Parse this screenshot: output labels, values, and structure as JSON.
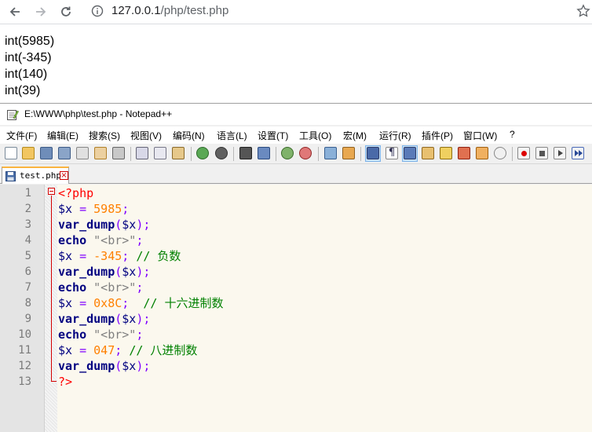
{
  "browser": {
    "url_host": "127.0.0.1",
    "url_path": "/php/test.php",
    "icons": [
      "back-arrow-icon",
      "forward-arrow-icon",
      "reload-icon",
      "info-icon",
      "bookmark-star-icon"
    ]
  },
  "page_output": [
    "int(5985)",
    "int(-345)",
    "int(140)",
    "int(39)"
  ],
  "notepad": {
    "title": "E:\\WWW\\php\\test.php - Notepad++",
    "menu": [
      "文件(F)",
      "编辑(E)",
      "搜索(S)",
      "视图(V)",
      "编码(N)",
      "语言(L)",
      "设置(T)",
      "工具(O)",
      "宏(M)",
      "运行(R)",
      "插件(P)",
      "窗口(W)",
      "?"
    ],
    "tab_label": "test.php",
    "current_line": 8,
    "colors": {
      "tag": "#ff0000",
      "variable": "#000080",
      "operator": "#8000ff",
      "number": "#ff8000",
      "keyword": "#000080",
      "string": "#808080",
      "comment": "#008000",
      "current_line_bg": "#e8e8ff",
      "tab_accent": "#fab440"
    },
    "code": [
      {
        "n": "1",
        "tokens": [
          {
            "t": "<?php",
            "c": "tag"
          }
        ]
      },
      {
        "n": "2",
        "tokens": [
          {
            "t": "$x",
            "c": "var"
          },
          {
            "t": " = ",
            "c": "op"
          },
          {
            "t": "5985",
            "c": "num"
          },
          {
            "t": ";",
            "c": "op"
          }
        ]
      },
      {
        "n": "3",
        "tokens": [
          {
            "t": "var_dump",
            "c": "fn"
          },
          {
            "t": "(",
            "c": "op"
          },
          {
            "t": "$x",
            "c": "var"
          },
          {
            "t": ");",
            "c": "op"
          }
        ]
      },
      {
        "n": "4",
        "tokens": [
          {
            "t": "echo",
            "c": "kw"
          },
          {
            "t": " ",
            "c": "op"
          },
          {
            "t": "\"<br>\"",
            "c": "str"
          },
          {
            "t": ";",
            "c": "op"
          }
        ]
      },
      {
        "n": "5",
        "tokens": [
          {
            "t": "$x",
            "c": "var"
          },
          {
            "t": " = ",
            "c": "op"
          },
          {
            "t": "-345",
            "c": "num"
          },
          {
            "t": "; ",
            "c": "op"
          },
          {
            "t": "// 负数",
            "c": "cmt"
          }
        ]
      },
      {
        "n": "6",
        "tokens": [
          {
            "t": "var_dump",
            "c": "fn"
          },
          {
            "t": "(",
            "c": "op"
          },
          {
            "t": "$x",
            "c": "var"
          },
          {
            "t": ");",
            "c": "op"
          }
        ]
      },
      {
        "n": "7",
        "tokens": [
          {
            "t": "echo",
            "c": "kw"
          },
          {
            "t": " ",
            "c": "op"
          },
          {
            "t": "\"<br>\"",
            "c": "str"
          },
          {
            "t": ";",
            "c": "op"
          }
        ]
      },
      {
        "n": "8",
        "tokens": [
          {
            "t": "$x",
            "c": "var"
          },
          {
            "t": " = ",
            "c": "op"
          },
          {
            "t": "0x8C",
            "c": "num"
          },
          {
            "t": ";  ",
            "c": "op"
          },
          {
            "t": "// 十六进制数",
            "c": "cmt"
          }
        ]
      },
      {
        "n": "9",
        "tokens": [
          {
            "t": "var_dump",
            "c": "fn"
          },
          {
            "t": "(",
            "c": "op"
          },
          {
            "t": "$x",
            "c": "var"
          },
          {
            "t": ");",
            "c": "op"
          }
        ]
      },
      {
        "n": "10",
        "tokens": [
          {
            "t": "echo",
            "c": "kw"
          },
          {
            "t": " ",
            "c": "op"
          },
          {
            "t": "\"<br>\"",
            "c": "str"
          },
          {
            "t": ";",
            "c": "op"
          }
        ]
      },
      {
        "n": "11",
        "tokens": [
          {
            "t": "$x",
            "c": "var"
          },
          {
            "t": " = ",
            "c": "op"
          },
          {
            "t": "047",
            "c": "num"
          },
          {
            "t": "; ",
            "c": "op"
          },
          {
            "t": "// 八进制数",
            "c": "cmt"
          }
        ]
      },
      {
        "n": "12",
        "tokens": [
          {
            "t": "var_dump",
            "c": "fn"
          },
          {
            "t": "(",
            "c": "op"
          },
          {
            "t": "$x",
            "c": "var"
          },
          {
            "t": ");",
            "c": "op"
          }
        ]
      },
      {
        "n": "13",
        "tokens": [
          {
            "t": "?>",
            "c": "tag"
          }
        ]
      }
    ]
  }
}
